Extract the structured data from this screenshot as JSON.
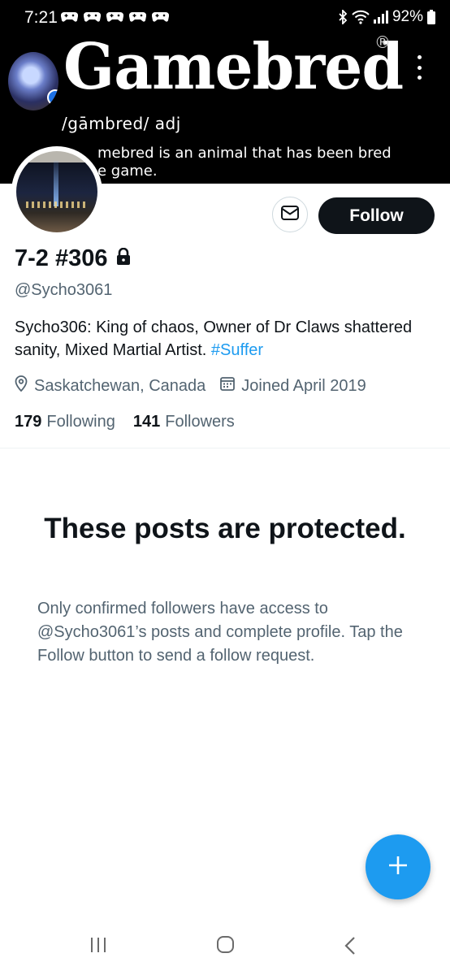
{
  "status_bar": {
    "time": "7:21",
    "battery": "92%"
  },
  "banner": {
    "brand": "Gamebred",
    "registered_mark": "®",
    "pronunciation": "/gāmbred/  adj",
    "definition_line1": "mebred is an animal that has been bred",
    "definition_line2": "e game."
  },
  "profile": {
    "display_name": "7-2 #306",
    "handle": "@Sycho3061",
    "bio_text": "Sycho306: King of chaos, Owner of Dr Claws shattered sanity, Mixed Martial Artist. ",
    "bio_hashtag": "#Suffer",
    "location": "Saskatchewan, Canada",
    "joined": "Joined April 2019",
    "following_count": "179",
    "following_label": "Following",
    "followers_count": "141",
    "followers_label": "Followers"
  },
  "actions": {
    "follow_label": "Follow"
  },
  "protected": {
    "title": "These posts are protected.",
    "body": "Only confirmed followers have access to @Sycho3061’s posts and complete profile. Tap the Follow button to send a follow request."
  },
  "colors": {
    "accent": "#1d9bf0",
    "text_primary": "#0f1419",
    "text_secondary": "#536471"
  },
  "icons": {
    "message": "mail-icon",
    "lock": "lock-icon",
    "location": "location-pin-icon",
    "calendar": "calendar-icon",
    "compose": "plus-icon"
  }
}
